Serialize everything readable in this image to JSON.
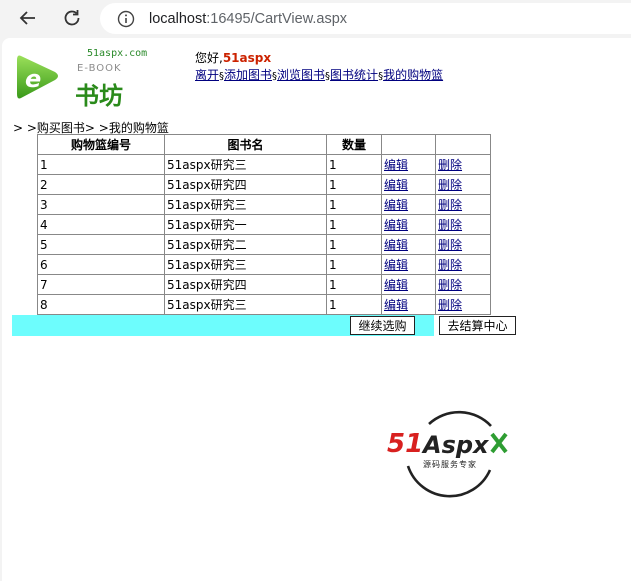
{
  "browser": {
    "url_host": "localhost",
    "url_path": ":16495/CartView.aspx"
  },
  "header": {
    "logo_domain": "51aspx.com",
    "logo_ebook": "E-BOOK",
    "logo_name": "书坊",
    "greeting_prefix": "您好,",
    "username": "51aspx",
    "menu": [
      {
        "label": "离开"
      },
      {
        "label": "添加图书"
      },
      {
        "label": "浏览图书"
      },
      {
        "label": "图书统计"
      },
      {
        "label": "我的购物篮"
      }
    ],
    "menu_separator": "§"
  },
  "breadcrumb": "> >购买图书> >我的购物篮",
  "cart": {
    "columns": [
      "购物篮编号",
      "图书名",
      "数量",
      "",
      ""
    ],
    "edit_label": "编辑",
    "delete_label": "删除",
    "rows": [
      {
        "id": "1",
        "title": "51aspx研究三",
        "qty": "1"
      },
      {
        "id": "2",
        "title": "51aspx研究四",
        "qty": "1"
      },
      {
        "id": "3",
        "title": "51aspx研究三",
        "qty": "1"
      },
      {
        "id": "4",
        "title": "51aspx研究一",
        "qty": "1"
      },
      {
        "id": "5",
        "title": "51aspx研究二",
        "qty": "1"
      },
      {
        "id": "6",
        "title": "51aspx研究三",
        "qty": "1"
      },
      {
        "id": "7",
        "title": "51aspx研究四",
        "qty": "1"
      },
      {
        "id": "8",
        "title": "51aspx研究三",
        "qty": "1"
      }
    ]
  },
  "actions": {
    "continue_label": "继续选购",
    "checkout_label": "去结算中心"
  },
  "brand": {
    "name_51": "51",
    "name_aspx": "Aspx",
    "tagline": "源码服务专家"
  },
  "colors": {
    "action_bar": "#6dfdfd",
    "username": "#cc2200",
    "link": "#00007f",
    "brand_red": "#d8201f",
    "brand_green": "#2e9d32"
  }
}
